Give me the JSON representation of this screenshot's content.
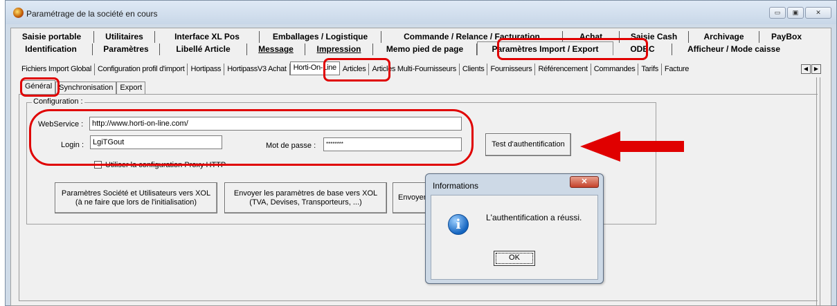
{
  "window": {
    "title": "Paramétrage de la société en cours",
    "buttons": {
      "minimize": "▭",
      "maximize": "▣",
      "close": "✕"
    }
  },
  "tabs_row1": [
    "Saisie portable",
    "Utilitaires",
    "Interface XL Pos",
    "Emballages / Logistique",
    "Commande / Relance / Facturation",
    "Achat",
    "Saisie Cash",
    "Archivage",
    "PayBox"
  ],
  "tabs_row2": [
    "Identification",
    "Paramètres",
    "Libellé Article",
    "Message",
    "Impression",
    "Memo pied de page",
    "Paramètres Import / Export",
    "ODBC",
    "Afficheur / Mode caisse"
  ],
  "subtabs": [
    "Fichiers Import Global",
    "Configuration profil d'import",
    "Hortipass",
    "HortipassV3 Achat",
    "Horti-On-Line",
    "Articles",
    "Articles Multi-Fournisseurs",
    "Clients",
    "Fournisseurs",
    "Référencement",
    "Commandes",
    "Tarifs",
    "Facture"
  ],
  "innertabs": [
    "Général",
    "Synchronisation",
    "Export"
  ],
  "config": {
    "group_label": "Configuration :",
    "webservice_label": "WebService :",
    "webservice_value": "http://www.horti-on-line.com/",
    "login_label": "Login :",
    "login_value": "LgiTGout",
    "password_label": "Mot de passe :",
    "password_value": "********",
    "test_button": "Test d'authentification",
    "proxy_checkbox": "Utiliser la configuration Proxy HTTP",
    "btn_societe": "Paramètres Société et Utilisateurs vers XOL\n(à ne faire que lors de l'initialisation)",
    "btn_base": "Envoyer les paramètres de base vers XOL\n(TVA, Devises, Transporteurs, ...)",
    "btn_envoyer": "Envoyer"
  },
  "dialog": {
    "title": "Informations",
    "message": "L'authentification a réussi.",
    "ok": "OK",
    "close": "✕"
  },
  "colors": {
    "highlight": "#e00000"
  }
}
